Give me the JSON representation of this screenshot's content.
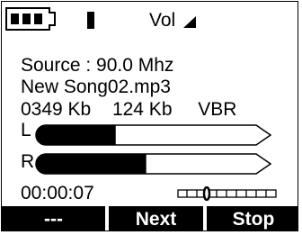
{
  "status_bar": {
    "battery_icon": "battery-icon",
    "signal_icon": "signal-bar-icon",
    "volume_label": "Vol",
    "volume_icon": "volume-ramp-icon"
  },
  "track": {
    "source": "Source : 90.0 Mhz",
    "title": "New Song02.mp3",
    "size": "0349 Kb",
    "bitrate": "124 Kb",
    "mode": "VBR"
  },
  "meters": {
    "left": {
      "label": "L",
      "level": 0.34
    },
    "right": {
      "label": "R",
      "level": 0.47
    }
  },
  "playback": {
    "elapsed": "00:00:07"
  },
  "softkeys": [
    {
      "label": "---"
    },
    {
      "label": "Next"
    },
    {
      "label": "Stop"
    }
  ],
  "colors": {
    "foreground": "#000000",
    "background": "#ffffff"
  }
}
